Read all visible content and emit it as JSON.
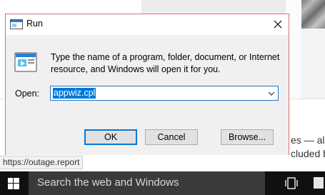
{
  "dialog": {
    "title": "Run",
    "description": "Type the name of a program, folder, document, or Internet resource, and Windows will open it for you.",
    "open_label": "Open:",
    "open_value": "appwiz.cpl",
    "buttons": {
      "ok": "OK",
      "cancel": "Cancel",
      "browse": "Browse..."
    }
  },
  "background": {
    "fragment_1": "es — all",
    "fragment_2": "cluded b",
    "status_url": "https://outage.report"
  },
  "taskbar": {
    "search_placeholder": "Search the web and Windows"
  },
  "colors": {
    "accent": "#0078d7",
    "dialog_border": "#e26e6e",
    "taskbar": "#101010"
  },
  "icons": [
    "run-icon",
    "close-icon",
    "chevron-down-icon",
    "windows-logo-icon",
    "task-view-icon",
    "taskbar-app-icon"
  ]
}
